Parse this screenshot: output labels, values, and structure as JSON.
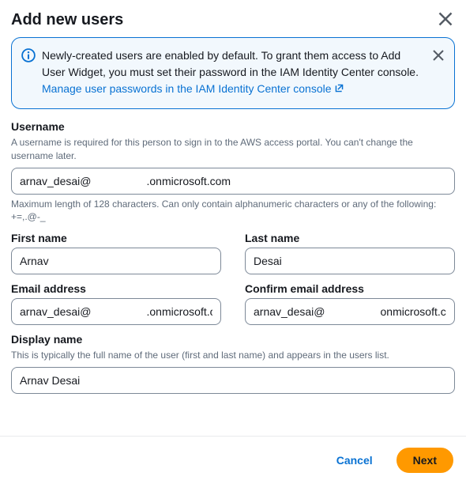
{
  "header": {
    "title": "Add new users"
  },
  "alert": {
    "text_before_link": "Newly-created users are enabled by default. To grant them access to Add User Widget, you must set their password in the IAM Identity Center console. ",
    "link_text": "Manage user passwords in the IAM Identity Center console"
  },
  "username": {
    "label": "Username",
    "desc": "A username is required for this person to sign in to the AWS access portal. You can't change the username later.",
    "value": "arnav_desai@                  .onmicrosoft.com",
    "help": "Maximum length of 128 characters. Can only contain alphanumeric characters or any of the following: +=,.@-_"
  },
  "first_name": {
    "label": "First name",
    "value": "Arnav"
  },
  "last_name": {
    "label": "Last name",
    "value": "Desai"
  },
  "email": {
    "label": "Email address",
    "value": "arnav_desai@                  .onmicrosoft.com"
  },
  "confirm_email": {
    "label": "Confirm email address",
    "value": "arnav_desai@                  onmicrosoft.com"
  },
  "display_name": {
    "label": "Display name",
    "desc": "This is typically the full name of the user (first and last name) and appears in the users list.",
    "value": "Arnav Desai"
  },
  "footer": {
    "cancel": "Cancel",
    "next": "Next"
  }
}
